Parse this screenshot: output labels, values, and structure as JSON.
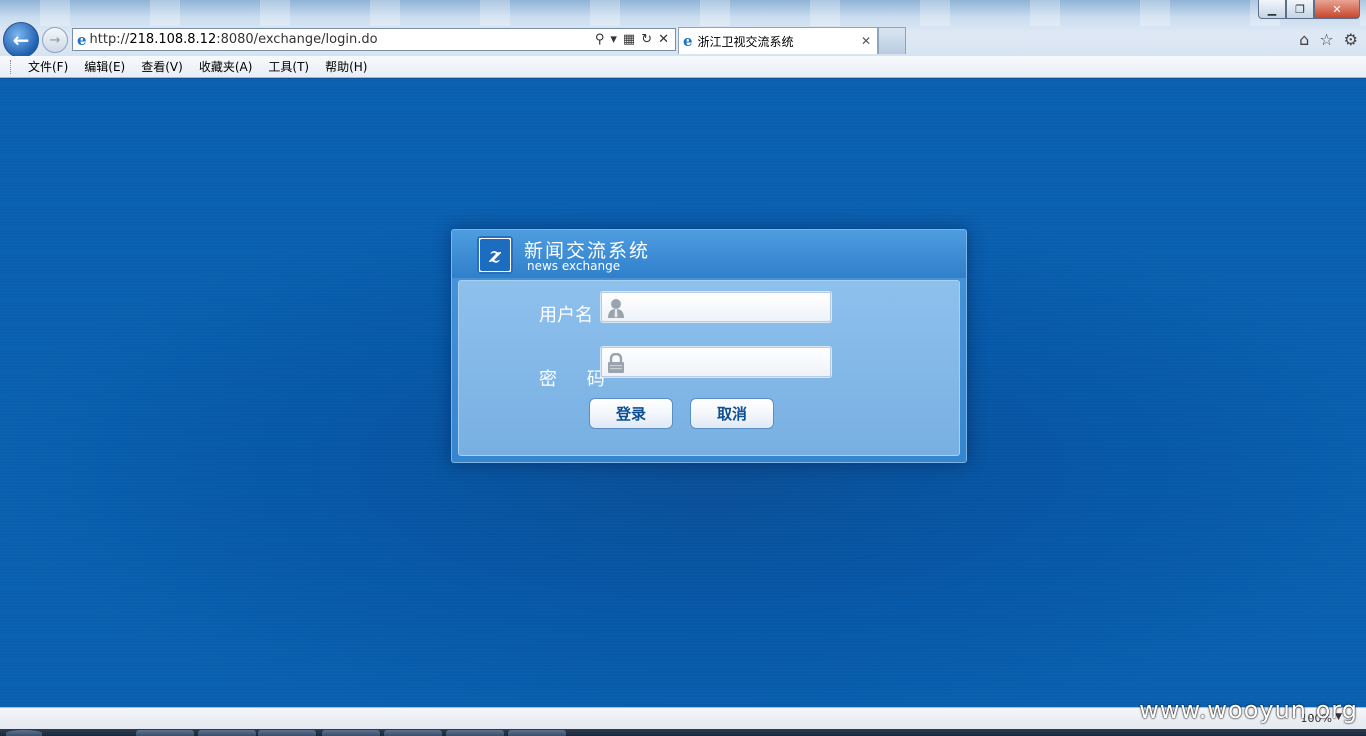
{
  "browser": {
    "url_prefix": "http://",
    "url_host": "218.108.8.12",
    "url_rest": ":8080/exchange/login.do",
    "tab_title": "浙江卫视交流系统",
    "window_buttons": {
      "minimize": "▁",
      "restore": "❐",
      "close": "✕"
    }
  },
  "menu": {
    "items": [
      "文件(F)",
      "编辑(E)",
      "查看(V)",
      "收藏夹(A)",
      "工具(T)",
      "帮助(H)"
    ]
  },
  "login": {
    "system_title": "新闻交流系统",
    "system_subtitle": "news exchange",
    "username_label": "用户名",
    "password_label": "密 码",
    "username_value": "",
    "password_value": "",
    "login_button": "登录",
    "cancel_button": "取消"
  },
  "status": {
    "zoom": "100%",
    "watermark": "www.wooyun.org"
  },
  "colors": {
    "page_background": "#0658a8",
    "panel": "#3585cf",
    "button_text": "#0c4f95"
  }
}
